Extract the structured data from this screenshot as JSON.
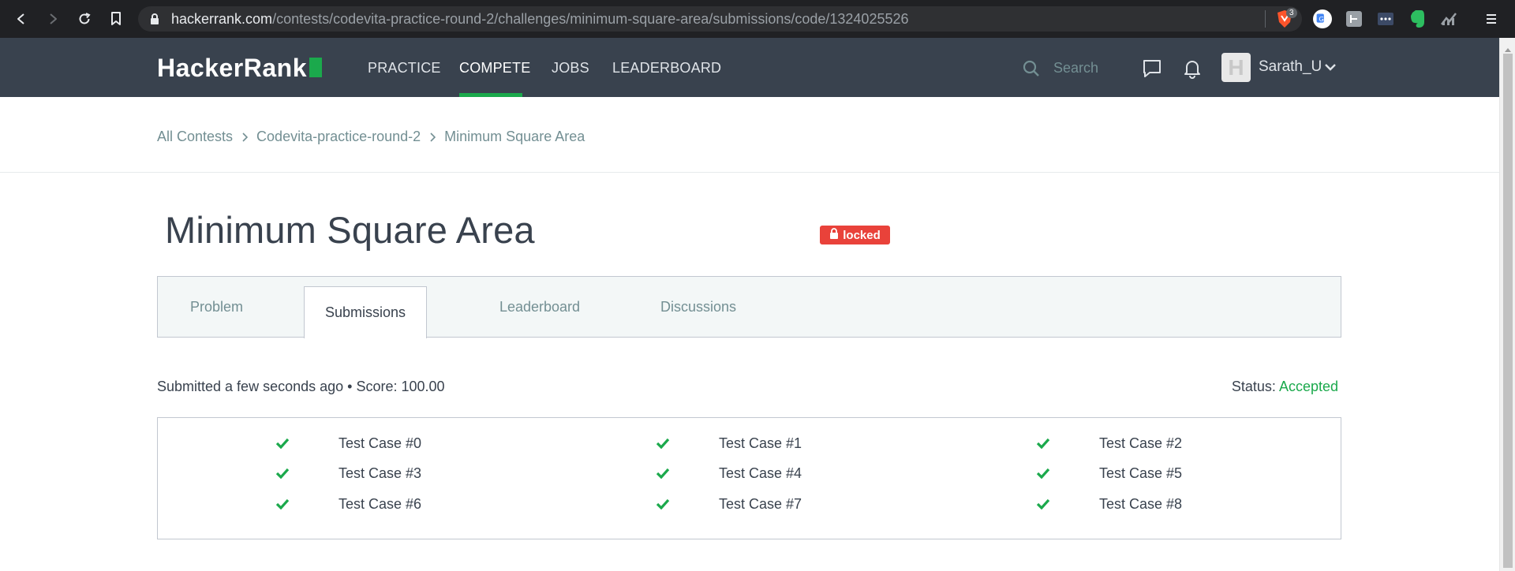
{
  "browser": {
    "url_host": "hackerrank.com",
    "url_path": "/contests/codevita-practice-round-2/challenges/minimum-square-area/submissions/code/1324025526",
    "brave_badge_count": "3"
  },
  "header": {
    "logo": "HackerRank",
    "nav": [
      "PRACTICE",
      "COMPETE",
      "JOBS",
      "LEADERBOARD"
    ],
    "active_nav": "COMPETE",
    "search_placeholder": "Search",
    "username": "Sarath_U",
    "avatar_letter": "H"
  },
  "breadcrumb": [
    "All Contests",
    "Codevita-practice-round-2",
    "Minimum Square Area"
  ],
  "challenge": {
    "title": "Minimum Square Area",
    "badge": "locked"
  },
  "tabs": [
    "Problem",
    "Submissions",
    "Leaderboard",
    "Discussions"
  ],
  "active_tab": "Submissions",
  "submission": {
    "summary": "Submitted a few seconds ago • Score: 100.00",
    "status_label": "Status:",
    "status_value": "Accepted"
  },
  "test_cases": [
    "Test Case #0",
    "Test Case #1",
    "Test Case #2",
    "Test Case #3",
    "Test Case #4",
    "Test Case #5",
    "Test Case #6",
    "Test Case #7",
    "Test Case #8"
  ],
  "colors": {
    "header_bg": "#39424e",
    "brand_green": "#1ba94c",
    "locked_red": "#e9423a"
  }
}
